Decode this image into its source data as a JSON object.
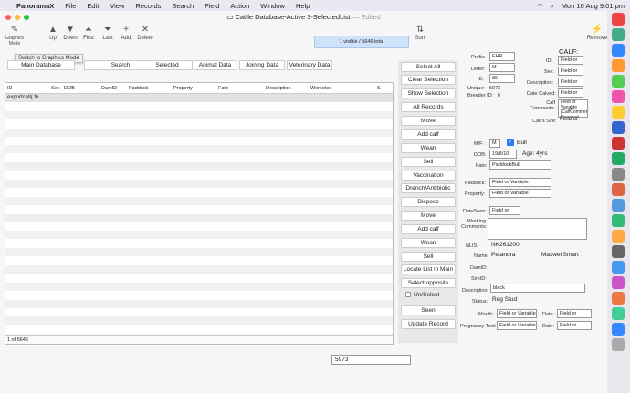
{
  "menubar": {
    "app": "PanoramaX",
    "items": [
      "File",
      "Edit",
      "View",
      "Records",
      "Search",
      "Field",
      "Action",
      "Window",
      "Help"
    ],
    "clock": "Mon 16 Aug  9:01 pm"
  },
  "window": {
    "title": "Cattle Database-Active 3-SelectedList",
    "edited": "— Edited"
  },
  "toolbar": {
    "tools": [
      "Graphics Mode",
      "Up",
      "Down",
      "First",
      "Last",
      "Add",
      "Delete"
    ],
    "status": "1 visible / 5646 total",
    "sort": "Sort",
    "remove": "Remove",
    "tooltip": "Switch to Graphics Mode"
  },
  "tabs": [
    "Main Database",
    "Search",
    "Selected",
    "Animal Data",
    "Joining Data",
    "Veterinary Data"
  ],
  "list": {
    "columns": [
      "ID",
      "Sex",
      "DOB",
      "DamID",
      "Paddock",
      "Property",
      "Fate",
      "Description",
      "Workotes",
      "S"
    ],
    "first_row": "exportcell( fu...",
    "footer": "1 of 5646"
  },
  "buttons": [
    "Select All",
    "Clear Selection",
    "Show Selection",
    "All Records",
    "Move",
    "Add calf",
    "Wean",
    "Sell",
    "Vaccination",
    "Drench/Antibiotic",
    "Dispose",
    "Move",
    "Add calf",
    "Wean",
    "Sell",
    "Locate List in Main",
    "Select opposite",
    "Un/Select",
    "Seen",
    "Update Record"
  ],
  "record": {
    "prefix_label": "Prefix:",
    "prefix": "EHR",
    "letter_label": "Letter:",
    "letter": "M",
    "id_label": "ID:",
    "id": "86",
    "unique_label": "Unique:",
    "unique": "5973",
    "breeder_label": "Breeder ID:",
    "breeder": "0",
    "calf_title": "CALF:",
    "calf_id_label": "ID:",
    "calf_id": "Field or",
    "calf_sex_label": "Sex:",
    "calf_sex": "Field or",
    "calf_desc_label": "Description:",
    "calf_desc": "Field or",
    "calf_dob_label": "Date Calved:",
    "calf_dob": "Field or",
    "calf_comments_label": "Calf Comments:",
    "calf_comments": "Field or Variable [CalfComments] Does not exist.",
    "calf_sire_label": "Calf's Sire:",
    "calf_sire": "Field or",
    "mf_label": "M/F:",
    "mf": "M",
    "bull": "Bull",
    "dob_label": "DOB:",
    "dob": "19/8/10",
    "age": "Age: 4yrs",
    "fate_label": "Fate:",
    "fate": "PaddockBull",
    "paddock_label": "Paddock:",
    "paddock": "Field or Variable [Paddock]",
    "property_label": "Property:",
    "property": "Field or Variable [Property]",
    "dateseen_label": "DateSeen:",
    "dateseen": "Field or",
    "working_label": "Working Comments:",
    "nlis_label": "NLIS:",
    "nlis": "NK261200",
    "name_label": "Name",
    "name": "Petandra",
    "name2": "MaxwellSmart",
    "damid_label": "DamID:",
    "sireid_label": "SireID:",
    "desc_label": "Description:",
    "desc": "black",
    "status_label": "Status:",
    "status": "Reg Stud",
    "mouth_label": "Mouth:",
    "mouth": "Field or Variable",
    "date_label": "Date:",
    "mouth_date": "Field or",
    "preg_label": "Pregnancy Test:",
    "preg": "Field or Variable",
    "preg_date": "Field or"
  },
  "bottom_field": "5973",
  "colors": {
    "accent": "#cfe2f9",
    "bg": "#f6f6f6"
  }
}
